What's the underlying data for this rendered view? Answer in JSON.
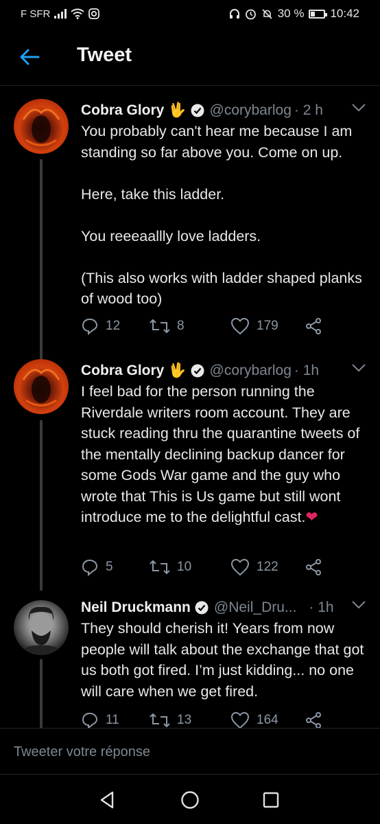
{
  "status_bar": {
    "carrier": "F SFR",
    "battery": "30 %",
    "time": "10:42"
  },
  "header": {
    "title": "Tweet"
  },
  "tweets": [
    {
      "name": "Cobra Glory",
      "emoji": "🖖",
      "handle": "@corybarlog",
      "time": "· 2 h",
      "paragraphs": [
        "You probably can't hear me because I am standing so far above you. Come on up.",
        "Here, take this ladder.",
        "You reeeaallly love ladders.",
        "(This also works with ladder shaped planks of wood too)"
      ],
      "replies": "12",
      "retweets": "8",
      "likes": "179"
    },
    {
      "name": "Cobra Glory",
      "emoji": "🖖",
      "handle": "@corybarlog",
      "time": "· 1h",
      "text": "I feel bad for the person running the Riverdale writers room account. They are stuck reading thru the quarantine tweets of the mentally declining backup dancer for some Gods War game and the guy who wrote that This is Us game but still wont introduce me to the delightful cast.",
      "heart": "❤",
      "replies": "5",
      "retweets": "10",
      "likes": "122"
    },
    {
      "name": "Neil Druckmann",
      "handle": "@Neil_Dru...",
      "time": "· 1h",
      "text": "They should cherish it! Years from now people will talk about the exchange that got us both got fired. I’m just kidding... no one will care when we get fired.",
      "replies": "11",
      "retweets": "13",
      "likes": "164"
    }
  ],
  "reply": {
    "placeholder": "Tweeter votre réponse"
  },
  "colors": {
    "accent": "#1da1f2",
    "muted": "#7d8791",
    "heart": "#e0245e"
  }
}
